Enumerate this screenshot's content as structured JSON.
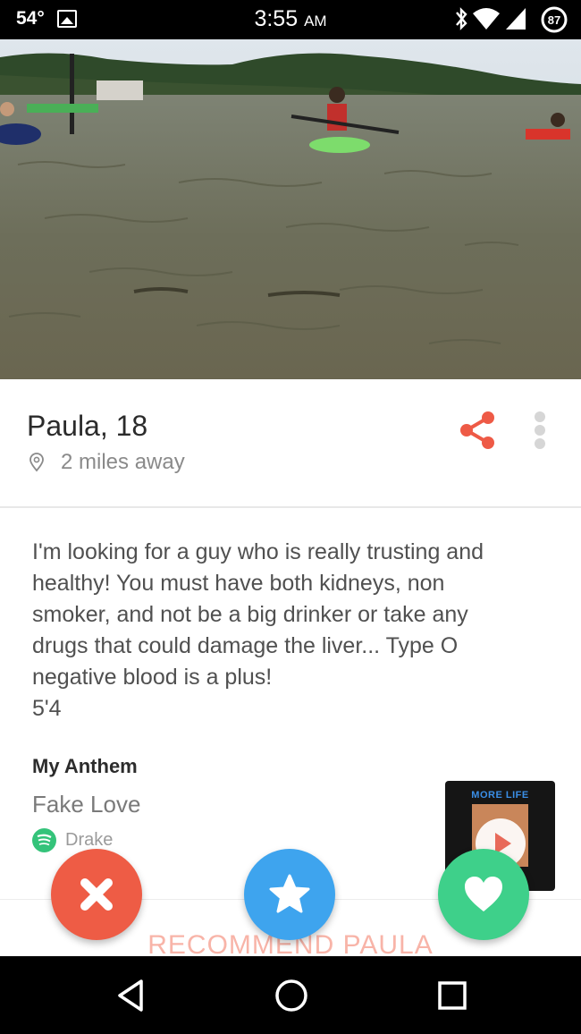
{
  "status_bar": {
    "temperature": "54°",
    "time": "3:55",
    "time_suffix": "AM",
    "battery": "87"
  },
  "profile": {
    "name": "Paula",
    "age": "18",
    "distance": "2 miles away"
  },
  "bio": {
    "lines": [
      "I'm looking for a guy who is really trusting and",
      "healthy! You must have both kidneys, non",
      "smoker, and not be a big drinker or take any",
      "drugs that could damage the liver... Type O",
      "negative blood is a plus!",
      "5'4"
    ]
  },
  "anthem": {
    "title": "My Anthem",
    "song": "Fake Love",
    "artist": "Drake",
    "album_label": "MORE LIFE"
  },
  "recommend_label": "RECOMMEND PAULA",
  "colors": {
    "share": "#ee5a46",
    "nope": "#ee5c45",
    "super_like": "#3ea4ee",
    "like": "#3ed08a",
    "spotify": "#34c37a"
  },
  "icons": [
    "share-icon",
    "more-options-icon",
    "location-pin-icon",
    "spotify-icon",
    "play-icon",
    "close-icon",
    "star-icon",
    "heart-icon",
    "back-icon",
    "home-icon",
    "recents-icon"
  ]
}
